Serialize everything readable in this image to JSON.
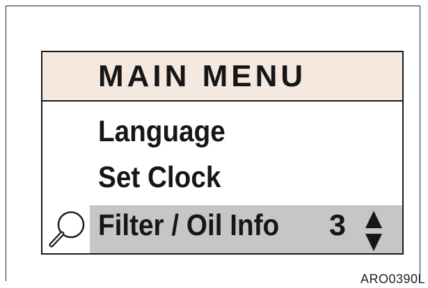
{
  "menu": {
    "title": "MAIN MENU",
    "items": [
      {
        "label": "Language"
      },
      {
        "label": "Set Clock"
      },
      {
        "label": "Filter / Oil Info",
        "count": "3",
        "selected": true
      }
    ]
  },
  "icons": {
    "magnifier": "magnifier-icon",
    "scroll": "up-down-arrow-icon"
  },
  "figure_code": "ARO0390L",
  "colors": {
    "header_bg": "#f4e8df",
    "selected_bg": "#c6c6c6",
    "text": "#161616"
  }
}
